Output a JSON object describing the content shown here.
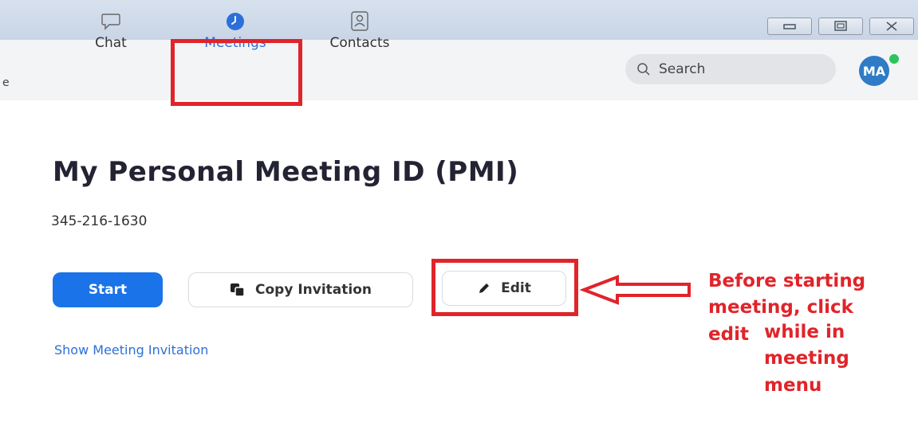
{
  "window": {
    "controls": [
      {
        "name": "minimize-button",
        "icon": "minimize-icon"
      },
      {
        "name": "maximize-button",
        "icon": "maximize-icon"
      },
      {
        "name": "close-button",
        "icon": "close-icon"
      }
    ]
  },
  "nav": {
    "edge_glyph": "e",
    "tabs": [
      {
        "label": "Chat",
        "icon": "chat-icon",
        "active": false
      },
      {
        "label": "Meetings",
        "icon": "clock-icon",
        "active": true
      },
      {
        "label": "Contacts",
        "icon": "contacts-icon",
        "active": false
      }
    ]
  },
  "search": {
    "placeholder": "Search",
    "icon": "search-icon"
  },
  "user": {
    "initials": "MA",
    "status": "online"
  },
  "main": {
    "title": "My Personal Meeting ID (PMI)",
    "meeting_id": "345-216-1630",
    "buttons": {
      "start": "Start",
      "copy": "Copy Invitation",
      "edit": "Edit"
    },
    "show_invitation": "Show Meeting Invitation"
  },
  "annotation": {
    "line1": "Before starting",
    "line2": "meeting, click",
    "line3a": "edit",
    "line3b": "while in",
    "line4": "meeting",
    "line5": "menu",
    "color": "#e0242a"
  },
  "colors": {
    "accent": "#2d6fd8",
    "primary_button": "#1a73e8",
    "highlight": "#e0242a"
  }
}
